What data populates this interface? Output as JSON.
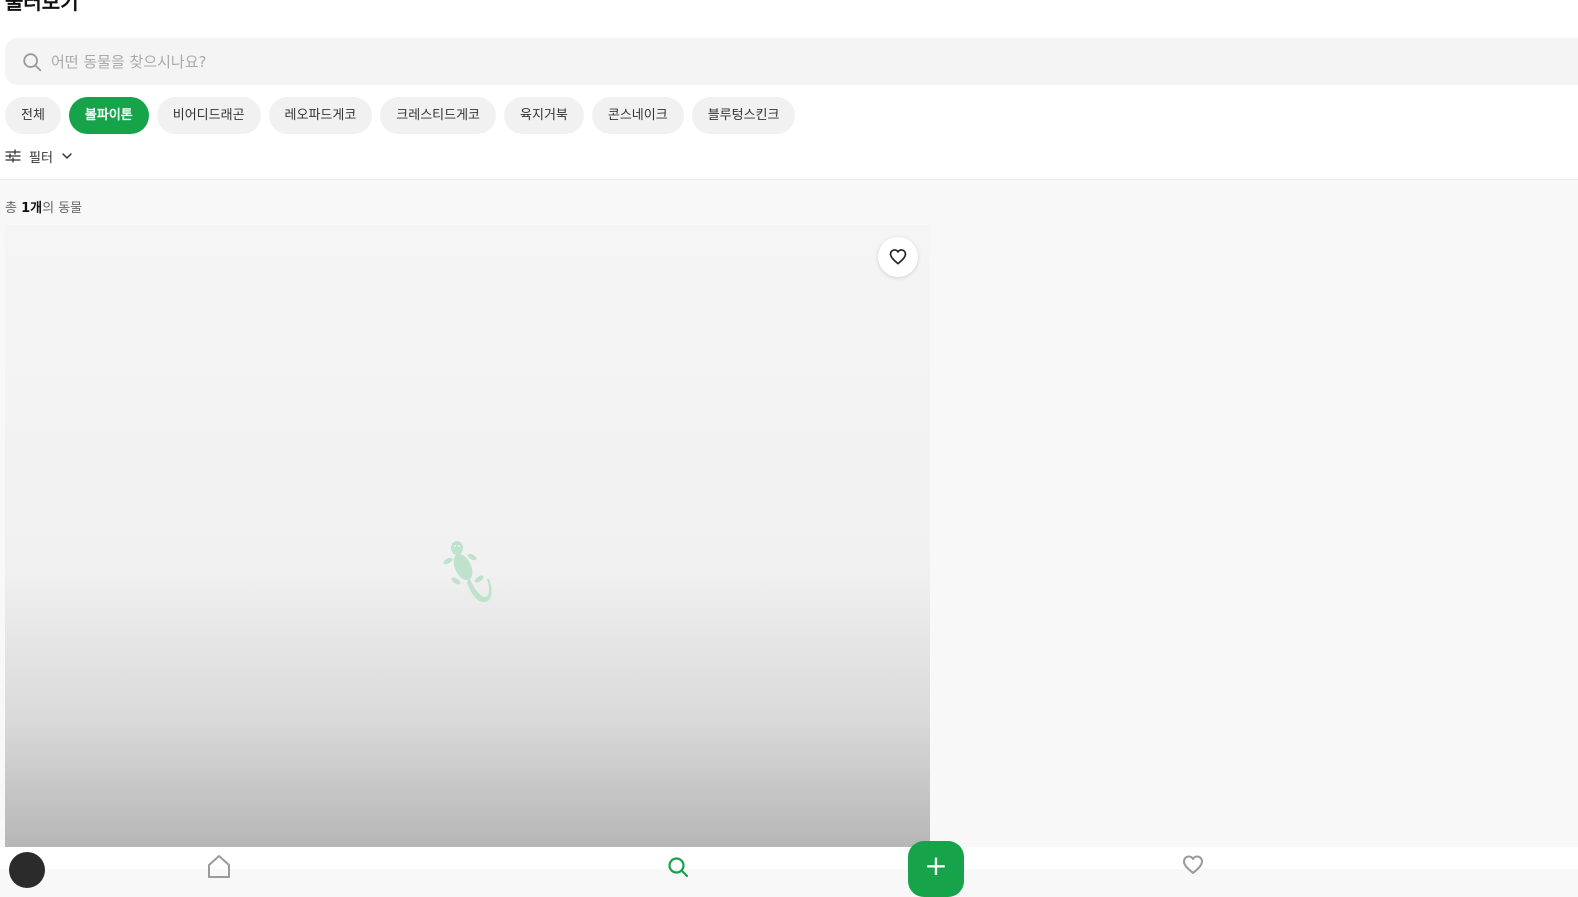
{
  "header": {
    "title": "둘러보기"
  },
  "search": {
    "placeholder": "어떤 동물을 찾으시나요?",
    "value": "",
    "icon": "search-icon"
  },
  "categories": [
    {
      "label": "전체",
      "active": false
    },
    {
      "label": "볼파이톤",
      "active": true
    },
    {
      "label": "비어디드래곤",
      "active": false
    },
    {
      "label": "레오파드게코",
      "active": false
    },
    {
      "label": "크레스티드게코",
      "active": false
    },
    {
      "label": "육지거북",
      "active": false
    },
    {
      "label": "콘스네이크",
      "active": false
    },
    {
      "label": "블루텅스킨크",
      "active": false
    }
  ],
  "filter": {
    "label": "필터",
    "icon": "sliders-icon"
  },
  "results": {
    "prefix": "총 ",
    "count": "1개",
    "suffix": "의 동물"
  },
  "listing": {
    "placeholder_icon": "gecko-icon",
    "favorite_icon": "heart-icon"
  },
  "bottom_nav": {
    "items": [
      "avatar",
      "home-icon",
      "search-icon",
      "add-icon",
      "heart-icon"
    ],
    "add_symbol": "+"
  },
  "colors": {
    "accent": "#16a34a",
    "chip_bg": "#f1f1f1",
    "search_bg": "#f4f4f4"
  }
}
